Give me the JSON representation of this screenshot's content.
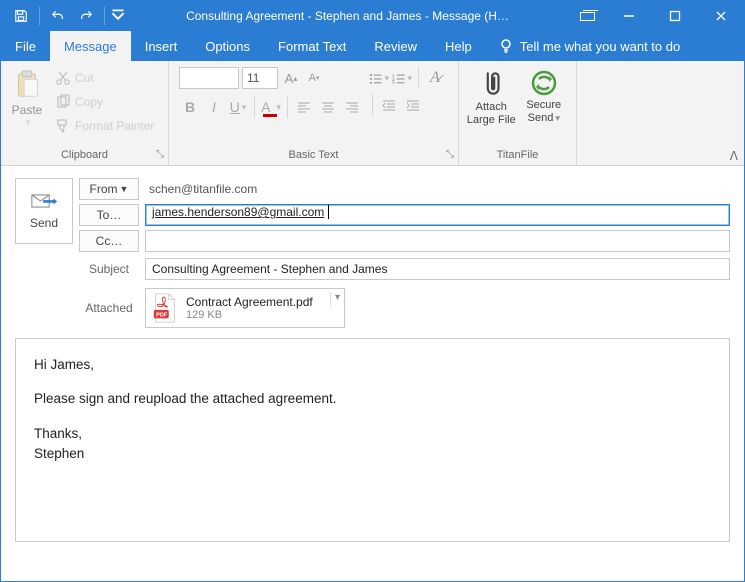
{
  "window": {
    "title": "Consulting Agreement - Stephen and James  -  Message (H…"
  },
  "tabs": {
    "file": "File",
    "message": "Message",
    "insert": "Insert",
    "options": "Options",
    "format_text": "Format Text",
    "review": "Review",
    "help": "Help",
    "tell_me": "Tell me what you want to do"
  },
  "ribbon": {
    "clipboard": {
      "label": "Clipboard",
      "paste": "Paste",
      "cut": "Cut",
      "copy": "Copy",
      "format_painter": "Format Painter"
    },
    "basic_text": {
      "label": "Basic Text",
      "font_name": "",
      "font_size": "11"
    },
    "titanfile": {
      "label": "TitanFile",
      "attach_large": "Attach Large File",
      "secure_send": "Secure Send"
    }
  },
  "compose": {
    "send": "Send",
    "from_label": "From",
    "from_value": "schen@titanfile.com",
    "to_label": "To…",
    "to_value": "james.henderson89@gmail.com",
    "cc_label": "Cc…",
    "cc_value": "",
    "subject_label": "Subject",
    "subject_value": "Consulting Agreement - Stephen and James",
    "attached_label": "Attached",
    "attachment": {
      "name": "Contract Agreement.pdf",
      "size": "129 KB"
    }
  },
  "body": {
    "greeting": "Hi James,",
    "para1": "Please sign and reupload the attached agreement.",
    "closing1": "Thanks,",
    "closing2": "Stephen"
  }
}
